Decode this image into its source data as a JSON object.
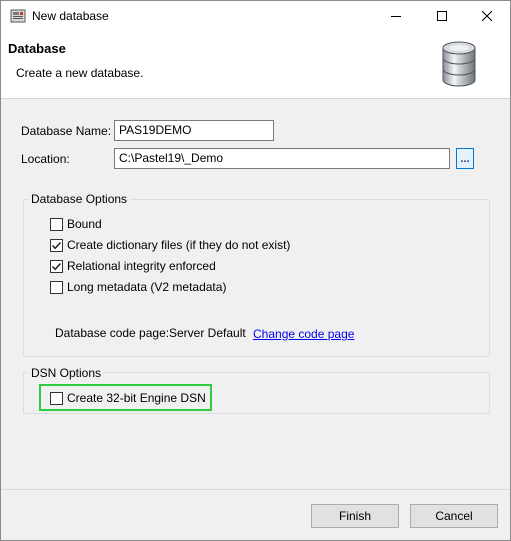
{
  "window": {
    "title": "New database"
  },
  "header": {
    "title": "Database",
    "subtitle": "Create a new database."
  },
  "form": {
    "name_label": "Database Name:",
    "name_value": "PAS19DEMO",
    "location_label": "Location:",
    "location_value": "C:\\Pastel19\\_Demo",
    "browse_label": "..."
  },
  "database_options": {
    "title": "Database Options",
    "items": [
      {
        "label": "Bound",
        "checked": false
      },
      {
        "label": "Create dictionary files (if they do not exist)",
        "checked": true
      },
      {
        "label": "Relational integrity enforced",
        "checked": true
      },
      {
        "label": "Long metadata (V2 metadata)",
        "checked": false
      }
    ],
    "code_page_label": "Database code page:",
    "code_page_value": "Server Default",
    "change_code_page_link": "Change code page"
  },
  "dsn_options": {
    "title": "DSN Options",
    "items": [
      {
        "label": "Create 32-bit Engine DSN",
        "checked": false
      }
    ]
  },
  "buttons": {
    "finish": "Finish",
    "cancel": "Cancel"
  },
  "colors": {
    "highlight": "#2ecc40",
    "link": "#0000ee",
    "accent": "#0078d7"
  }
}
